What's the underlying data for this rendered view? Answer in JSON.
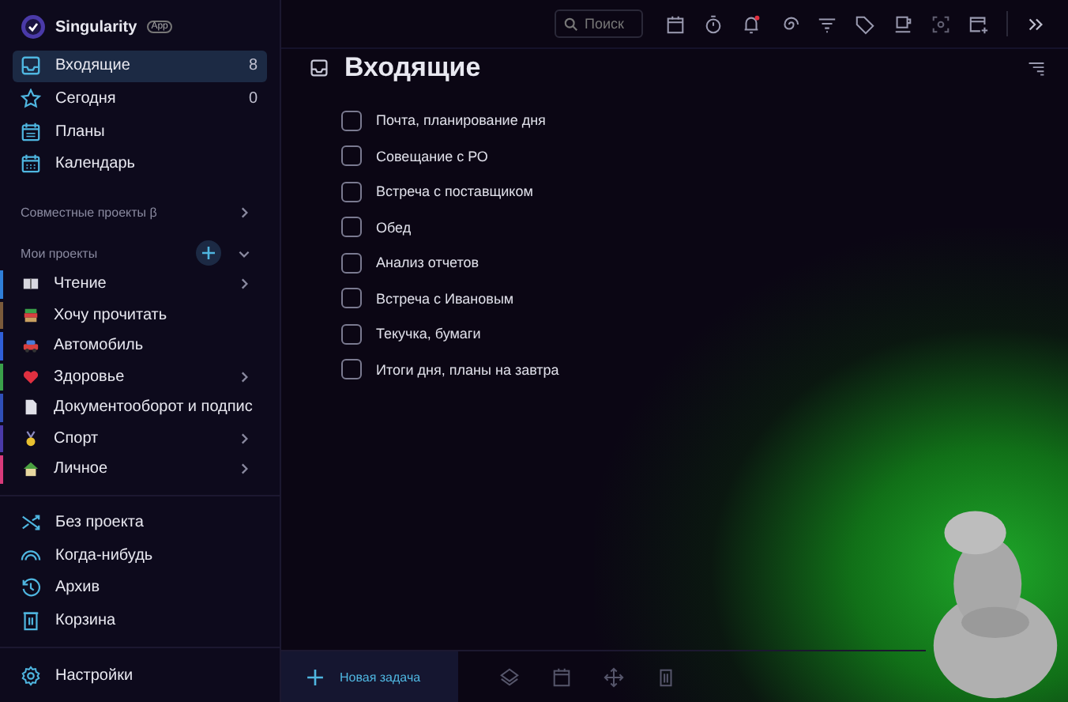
{
  "app": {
    "name": "Singularity",
    "badge": "App"
  },
  "nav": [
    {
      "label": "Входящие",
      "count": "8",
      "selected": true
    },
    {
      "label": "Сегодня",
      "count": "0",
      "selected": false
    },
    {
      "label": "Планы",
      "selected": false
    },
    {
      "label": "Календарь",
      "selected": false
    }
  ],
  "shared_projects": {
    "label": "Совместные проекты β"
  },
  "my_projects": {
    "label": "Мои проекты",
    "expanded": true,
    "items": [
      {
        "label": "Чтение",
        "color": "#2f7fd8",
        "expandable": true
      },
      {
        "label": "Хочу прочитать",
        "color": "#7a5a3a",
        "expandable": false
      },
      {
        "label": "Автомобиль",
        "color": "#2f5fd8",
        "expandable": false
      },
      {
        "label": "Здоровье",
        "color": "#3aa04a",
        "expandable": true
      },
      {
        "label": "Документооборот и подпис",
        "color": "#2f4fb8",
        "expandable": false
      },
      {
        "label": "Спорт",
        "color": "#4a3aa8",
        "expandable": true
      },
      {
        "label": "Личное",
        "color": "#d83a7a",
        "expandable": true
      }
    ]
  },
  "lists": [
    {
      "label": "Без проекта"
    },
    {
      "label": "Когда-нибудь"
    },
    {
      "label": "Архив"
    },
    {
      "label": "Корзина"
    }
  ],
  "settings": {
    "label": "Настройки"
  },
  "toolbar": {
    "search_placeholder": "Поиск",
    "notification": true
  },
  "page": {
    "title": "Входящие"
  },
  "tasks": [
    {
      "title": "Почта, планирование дня",
      "checked": false
    },
    {
      "title": "Совещание с РО",
      "checked": false
    },
    {
      "title": "Встреча с поставщиком",
      "checked": false
    },
    {
      "title": "Обед",
      "checked": false
    },
    {
      "title": "Анализ отчетов",
      "checked": false
    },
    {
      "title": "Встреча с Ивановым",
      "checked": false
    },
    {
      "title": "Текучка, бумаги",
      "checked": false
    },
    {
      "title": "Итоги дня, планы на завтра",
      "checked": false
    }
  ],
  "bottom_bar": {
    "new_task": "Новая задача"
  }
}
